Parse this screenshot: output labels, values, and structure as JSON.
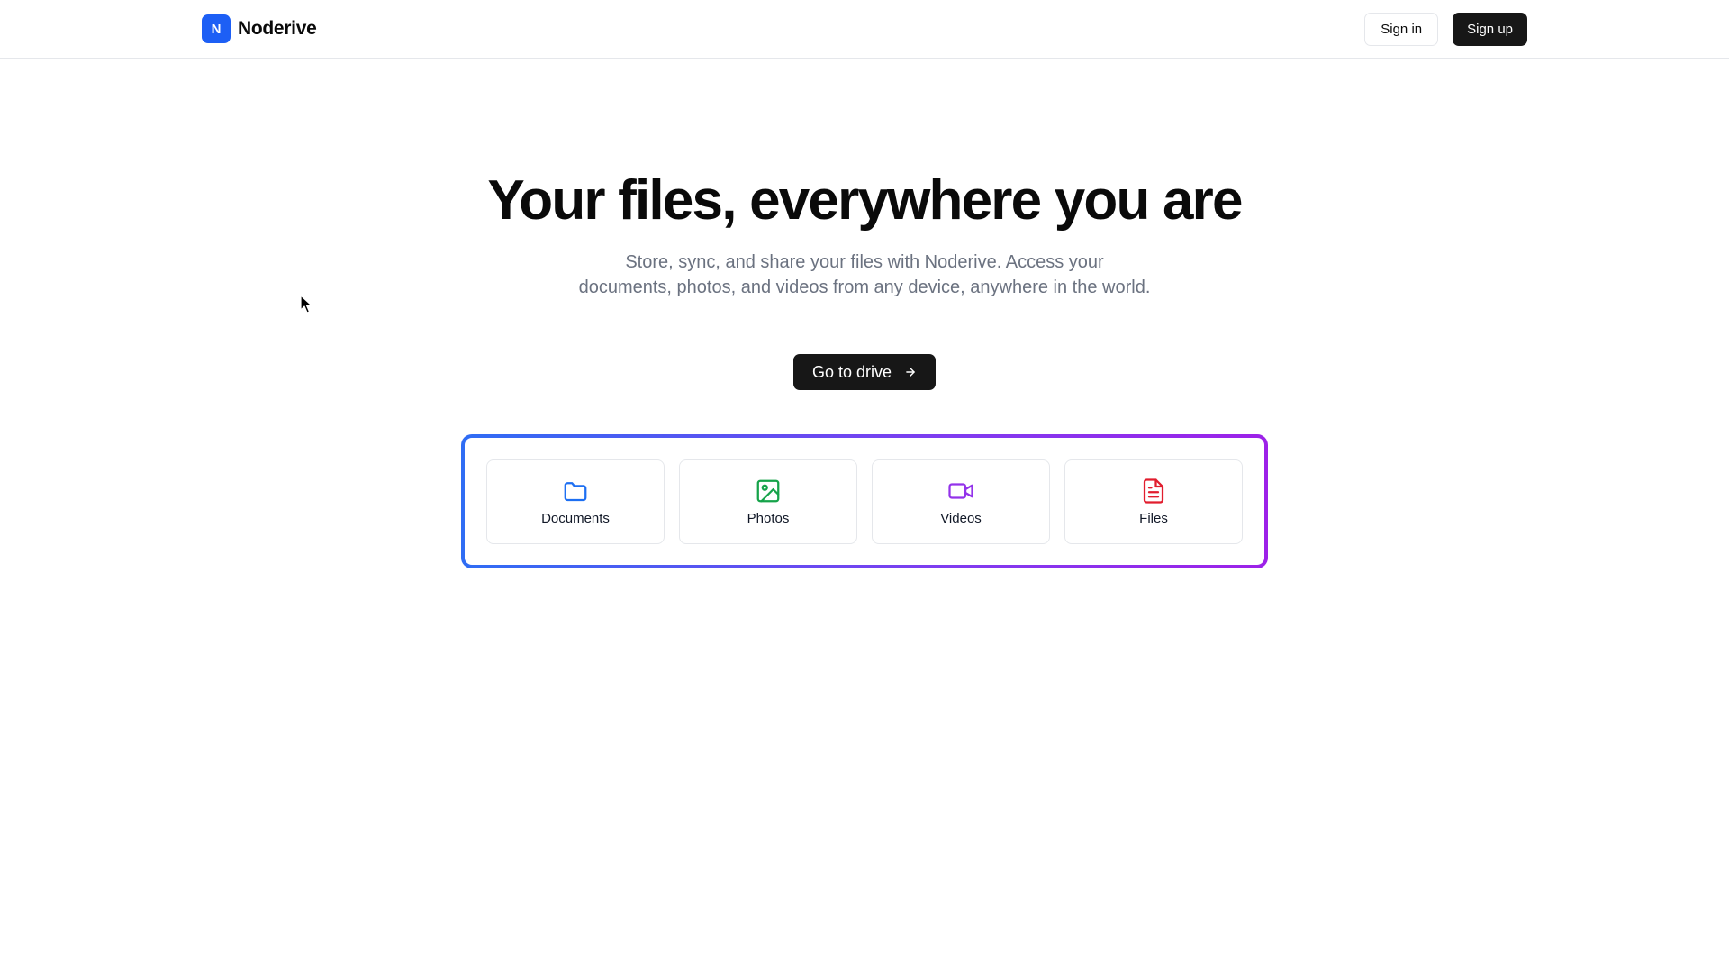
{
  "header": {
    "brand_letter": "N",
    "brand_name": "Noderive",
    "sign_in_label": "Sign in",
    "sign_up_label": "Sign up",
    "brand_color": "#1d5ff5"
  },
  "hero": {
    "title": "Your files, everywhere you are",
    "subtitle": "Store, sync, and share your files with Noderive. Access your documents, photos, and videos from any device, anywhere in the world.",
    "cta_label": "Go to drive",
    "cta_icon": "arrow-right-icon"
  },
  "categories": [
    {
      "label": "Documents",
      "icon": "folder-icon",
      "color": "#1d6ff2"
    },
    {
      "label": "Photos",
      "icon": "image-icon",
      "color": "#16a34a"
    },
    {
      "label": "Videos",
      "icon": "video-icon",
      "color": "#9333ea"
    },
    {
      "label": "Files",
      "icon": "file-text-icon",
      "color": "#e11d2e"
    }
  ],
  "panel_gradient": [
    "#2f6df4",
    "#9d21e8"
  ]
}
